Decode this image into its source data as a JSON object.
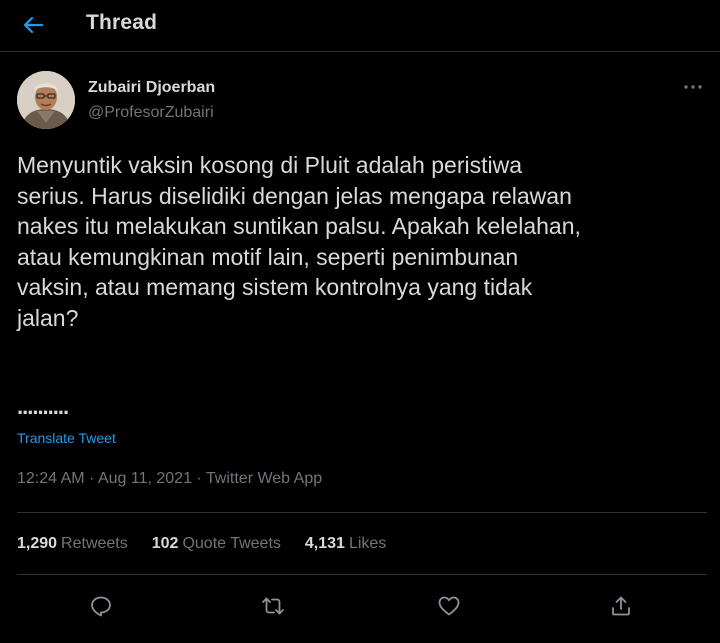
{
  "header": {
    "back_icon": "arrow-left-icon",
    "title": "Thread"
  },
  "tweet": {
    "author": {
      "name": "Zubairi Djoerban",
      "handle": "@ProfesorZubairi"
    },
    "more_icon": "more-horizontal-icon",
    "text": "Menyuntik vaksin kosong di Pluit adalah peristiwa\nserius. Harus diselidiki dengan jelas mengapa relawan\nnakes itu melakukan suntikan palsu. Apakah kelelahan,\natau kemungkinan motif lain, seperti penimbunan\nvaksin, atau memang sistem kontrolnya yang tidak\njalan?",
    "ellipsis": "..........",
    "translate_label": "Translate Tweet",
    "time": "12:24 AM",
    "date": "Aug 11, 2021",
    "source": "Twitter Web App",
    "separator": " · "
  },
  "stats": {
    "retweets": {
      "count": "1,290",
      "label": "Retweets"
    },
    "quotes": {
      "count": "102",
      "label": "Quote Tweets"
    },
    "likes": {
      "count": "4,131",
      "label": "Likes"
    }
  },
  "actions": [
    {
      "name": "reply",
      "icon": "reply-icon"
    },
    {
      "name": "retweet",
      "icon": "retweet-icon"
    },
    {
      "name": "like",
      "icon": "heart-icon"
    },
    {
      "name": "share",
      "icon": "share-icon"
    }
  ],
  "colors": {
    "background": "#000000",
    "text": "#d9d9d9",
    "muted": "#6e767d",
    "accent": "#1d9bf0",
    "divider": "#2f3336"
  }
}
